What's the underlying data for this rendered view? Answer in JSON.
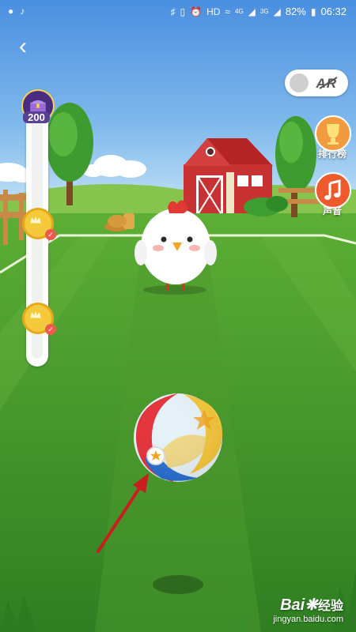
{
  "statusbar": {
    "battery": "82%",
    "time": "06:32",
    "network_4g": "4G",
    "network_3g": "3G",
    "hd_badge": "HD"
  },
  "toggle": {
    "ar_label": "AR",
    "enabled": false
  },
  "side_buttons": {
    "leaderboard_label": "排行榜",
    "sound_label": "声音"
  },
  "progress": {
    "chest_value": "200",
    "milestones_completed": 2
  },
  "watermark": {
    "brand": "Bai",
    "brand_suffix": "经验",
    "url": "jingyan.baidu.com"
  },
  "colors": {
    "sky_top": "#4a8fe0",
    "grass": "#4ea330",
    "barn_red": "#c83232",
    "ball_yellow": "#f5c73b",
    "ball_red": "#e6333c",
    "ball_blue": "#2a6fd1",
    "arrow": "#c81e1e"
  },
  "icons": {
    "back": "back-arrow-icon",
    "leaderboard": "trophy-icon",
    "sound": "music-note-icon",
    "coin": "coin-icon",
    "chest": "treasure-chest-icon"
  }
}
